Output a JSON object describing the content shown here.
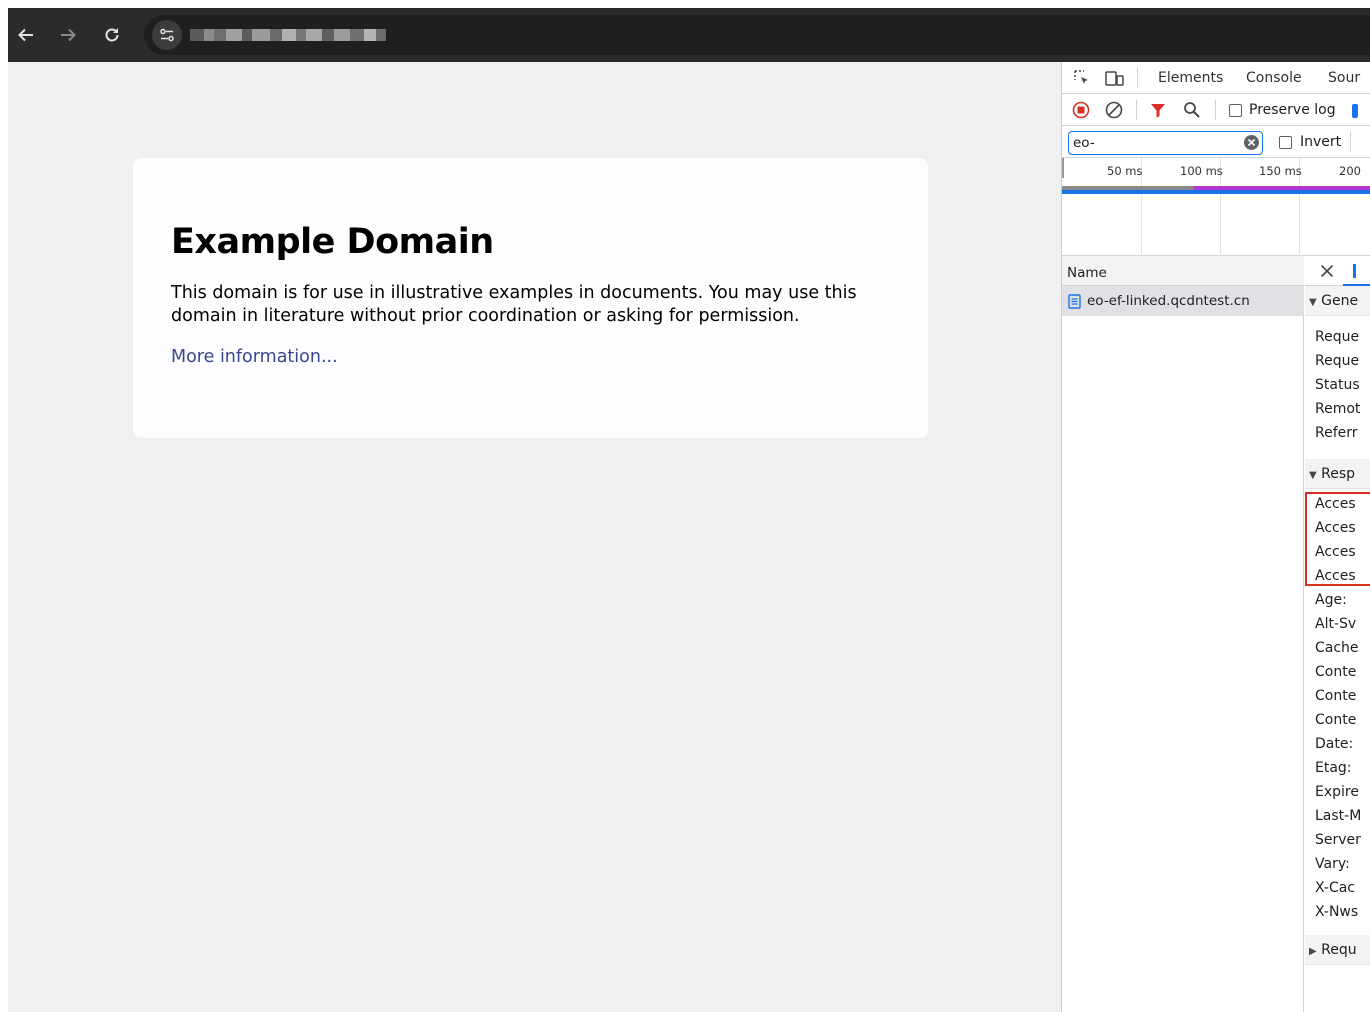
{
  "browser": {
    "icons": {
      "back": "arrow-left-icon",
      "forward": "arrow-right-icon",
      "reload": "reload-icon",
      "site_info": "tune-icon"
    }
  },
  "page": {
    "heading": "Example Domain",
    "body": "This domain is for use in illustrative examples in documents. You may use this domain in literature without prior coordination or asking for permission.",
    "link": "More information..."
  },
  "devtools": {
    "tabs": [
      "Elements",
      "Console",
      "Sour"
    ],
    "preserve_log": "Preserve log",
    "filter_value": "eo-",
    "invert": "Invert",
    "ticks": [
      "50 ms",
      "100 ms",
      "150 ms",
      "200"
    ],
    "name_header": "Name",
    "request": "eo-ef-linked.qcdntest.cn",
    "sections": {
      "general": "Gene",
      "response": "Resp",
      "request": "Requ"
    },
    "general_rows": [
      "Reque",
      "Reque",
      "Status",
      "Remot",
      "Referr"
    ],
    "response_rows": [
      "Acces",
      "Acces",
      "Acces",
      "Acces",
      "Age:",
      "Alt-Sv",
      "Cache",
      "Conte",
      "Conte",
      "Conte",
      "Date:",
      "Etag:",
      "Expire",
      "Last-M",
      "Server",
      "Vary:",
      "X-Cac",
      "X-Nws"
    ],
    "colors": {
      "accent": "#1a73e8",
      "record": "#d93025",
      "filter": "#d93025",
      "highlight_box": "#d93025"
    }
  }
}
